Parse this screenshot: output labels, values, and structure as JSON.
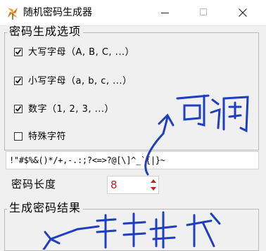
{
  "window": {
    "title": "随机密码生成器",
    "icon": "pinwheel-icon",
    "controls": [
      "minimize",
      "maximize",
      "close"
    ]
  },
  "options_group": {
    "title": "密码生成选项",
    "items": [
      {
        "label": "大写字母（A, B, C, ...）",
        "checked": true
      },
      {
        "label": "小写字母（a, b, c, ...）",
        "checked": true
      },
      {
        "label": "数字（1, 2, 3, ...）",
        "checked": true
      },
      {
        "label": "特殊字符",
        "checked": false
      }
    ]
  },
  "special_chars": "!\"#$%&()*/+,-.:;?<=>?@[\\]^_`{|}~",
  "length": {
    "label": "密码长度",
    "value": "8"
  },
  "result_group": {
    "title": "生成密码结果",
    "value": ""
  },
  "annotations": {
    "adjustable": "可调",
    "click_generate": "单击生成",
    "ink_color": "#1f3fbf"
  }
}
